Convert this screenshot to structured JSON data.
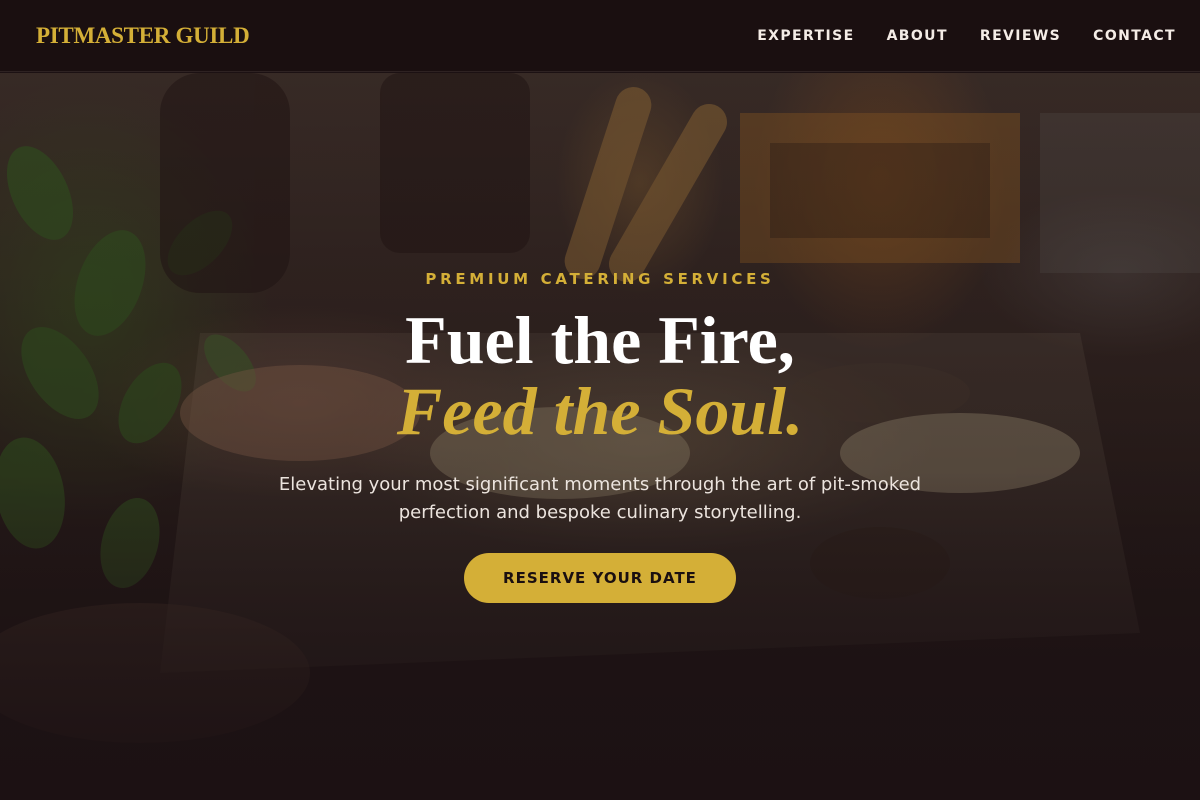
{
  "nav": {
    "logo": "PITMASTER GUILD",
    "links": [
      {
        "label": "EXPERTISE"
      },
      {
        "label": "ABOUT"
      },
      {
        "label": "REVIEWS"
      },
      {
        "label": "CONTACT"
      }
    ]
  },
  "hero": {
    "eyebrow": "PREMIUM CATERING SERVICES",
    "headline_line1": "Fuel the Fire,",
    "headline_line2": "Feed the Soul.",
    "subtitle": "Elevating your most significant moments through the art of pit-smoked perfection and bespoke culinary storytelling.",
    "cta_label": "RESERVE YOUR DATE",
    "background_image": "catering-buffet-photo"
  },
  "colors": {
    "accent_gold": "#d4af37",
    "nav_background": "#1a0f10",
    "page_background": "#1c1113",
    "text_light": "#ffffff"
  }
}
